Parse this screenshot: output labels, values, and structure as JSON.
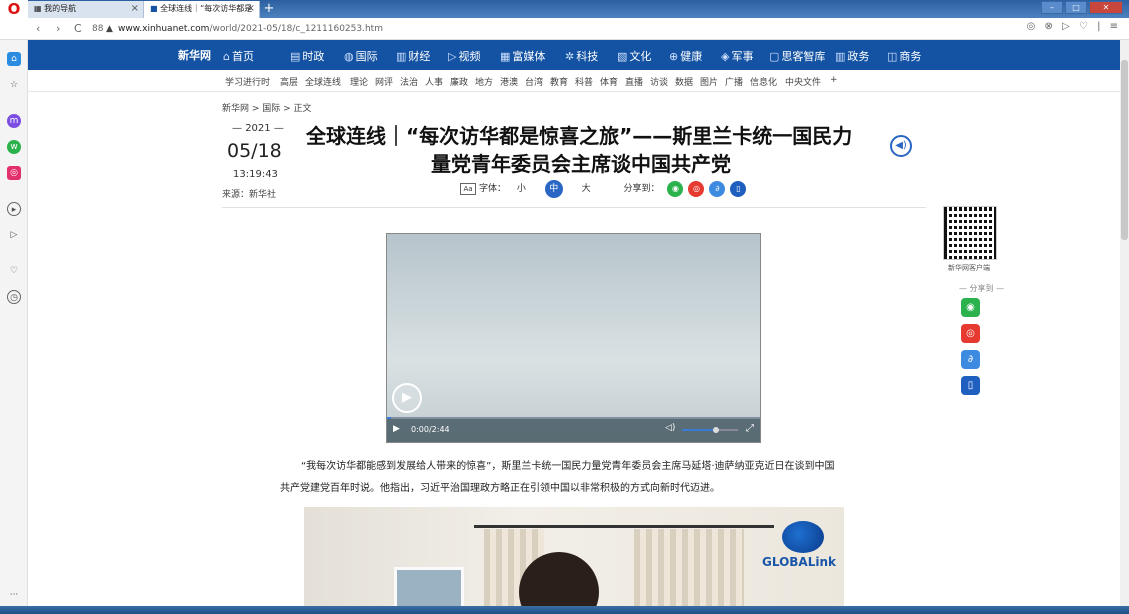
{
  "browser": {
    "logo": "O",
    "tabs": [
      {
        "label": "我的导航",
        "icon": "grid-icon",
        "close": "×"
      },
      {
        "label": "全球连线｜“每次访华都是",
        "icon": "xinhua-icon",
        "close": "×"
      }
    ],
    "new_tab": "+",
    "nav": {
      "back": "‹",
      "forward": "›",
      "reload": "C",
      "grid": "88",
      "warning": "▲"
    },
    "url_domain": "www.xinhuanet.com",
    "url_path": "/world/2021-05/18/c_1211160253.htm",
    "addr_right_icons": "◎ ⊗ ▷ ♡ | ≡",
    "window_controls": {
      "min": "–",
      "max": "□",
      "close": "✕"
    }
  },
  "sidebar_icons": [
    "home-icon",
    "star-icon",
    "messenger-icon",
    "whatsapp-icon",
    "instagram-icon",
    "player-icon",
    "send-icon",
    "heart-icon",
    "history-icon",
    "more-icon"
  ],
  "site": {
    "logo": "新华网",
    "nav": [
      {
        "icon": "⌂",
        "label": "首页"
      },
      {
        "icon": "▤",
        "label": "时政"
      },
      {
        "icon": "◍",
        "label": "国际"
      },
      {
        "icon": "▥",
        "label": "财经"
      },
      {
        "icon": "▷",
        "label": "视频"
      },
      {
        "icon": "▦",
        "label": "富媒体"
      },
      {
        "icon": "✲",
        "label": "科技"
      },
      {
        "icon": "▧",
        "label": "文化"
      },
      {
        "icon": "⊕",
        "label": "健康"
      },
      {
        "icon": "◈",
        "label": "军事"
      },
      {
        "icon": "▢",
        "label": "思客智库"
      },
      {
        "icon": "▥",
        "label": "政务"
      },
      {
        "icon": "◫",
        "label": "商务"
      }
    ],
    "subnav": [
      "学习进行时",
      "高层",
      "全球连线",
      "理论",
      "网评",
      "法治",
      "人事",
      "廉政",
      "地方",
      "港澳",
      "台湾",
      "教育",
      "科普",
      "体育",
      "直播",
      "访谈",
      "数据",
      "图片",
      "广播",
      "信息化",
      "中央文件",
      "+"
    ]
  },
  "article": {
    "breadcrumb": "新华网 > 国际 > 正文",
    "year": "2021",
    "date": "05/18",
    "time": "13:19:43",
    "source": "来源：新华社",
    "title_line1": "全球连线｜“每次访华都是惊喜之旅”——斯里兰卡统一国民力",
    "title_line2": "量党青年委员会主席谈中国共产党",
    "font_label": "字体：",
    "font_small": "小",
    "font_medium": "中",
    "font_large": "大",
    "share_label": "分享到：",
    "aa_icon": "Aa",
    "paragraph_line1": "“我每次访华都能感到发展给人带来的惊喜”，斯里兰卡统一国民力量党青年委员会主席马延塔·迪萨纳亚克近日在谈到中国",
    "paragraph_line2": "共产党建党百年时说。他指出，习近平治国理政方略正在引领中国以非常积极的方式向新时代迈进。"
  },
  "video": {
    "current_time": "0:00",
    "duration": "2:44",
    "time_display": "0:00/2:44",
    "progress_fraction": 0.01,
    "volume_fraction": 0.6
  },
  "image": {
    "watermark": "GLOBALink"
  },
  "right_panel": {
    "qr_label": "新华网客户端",
    "share_label": "分享到"
  },
  "colors": {
    "nav_blue": "#1453a3",
    "accent_blue": "#2a66c4",
    "wechat_green": "#2bb24c",
    "weibo_red": "#e6392f",
    "link_blue": "#3d8be0",
    "phone_blue": "#1f5fbf"
  }
}
